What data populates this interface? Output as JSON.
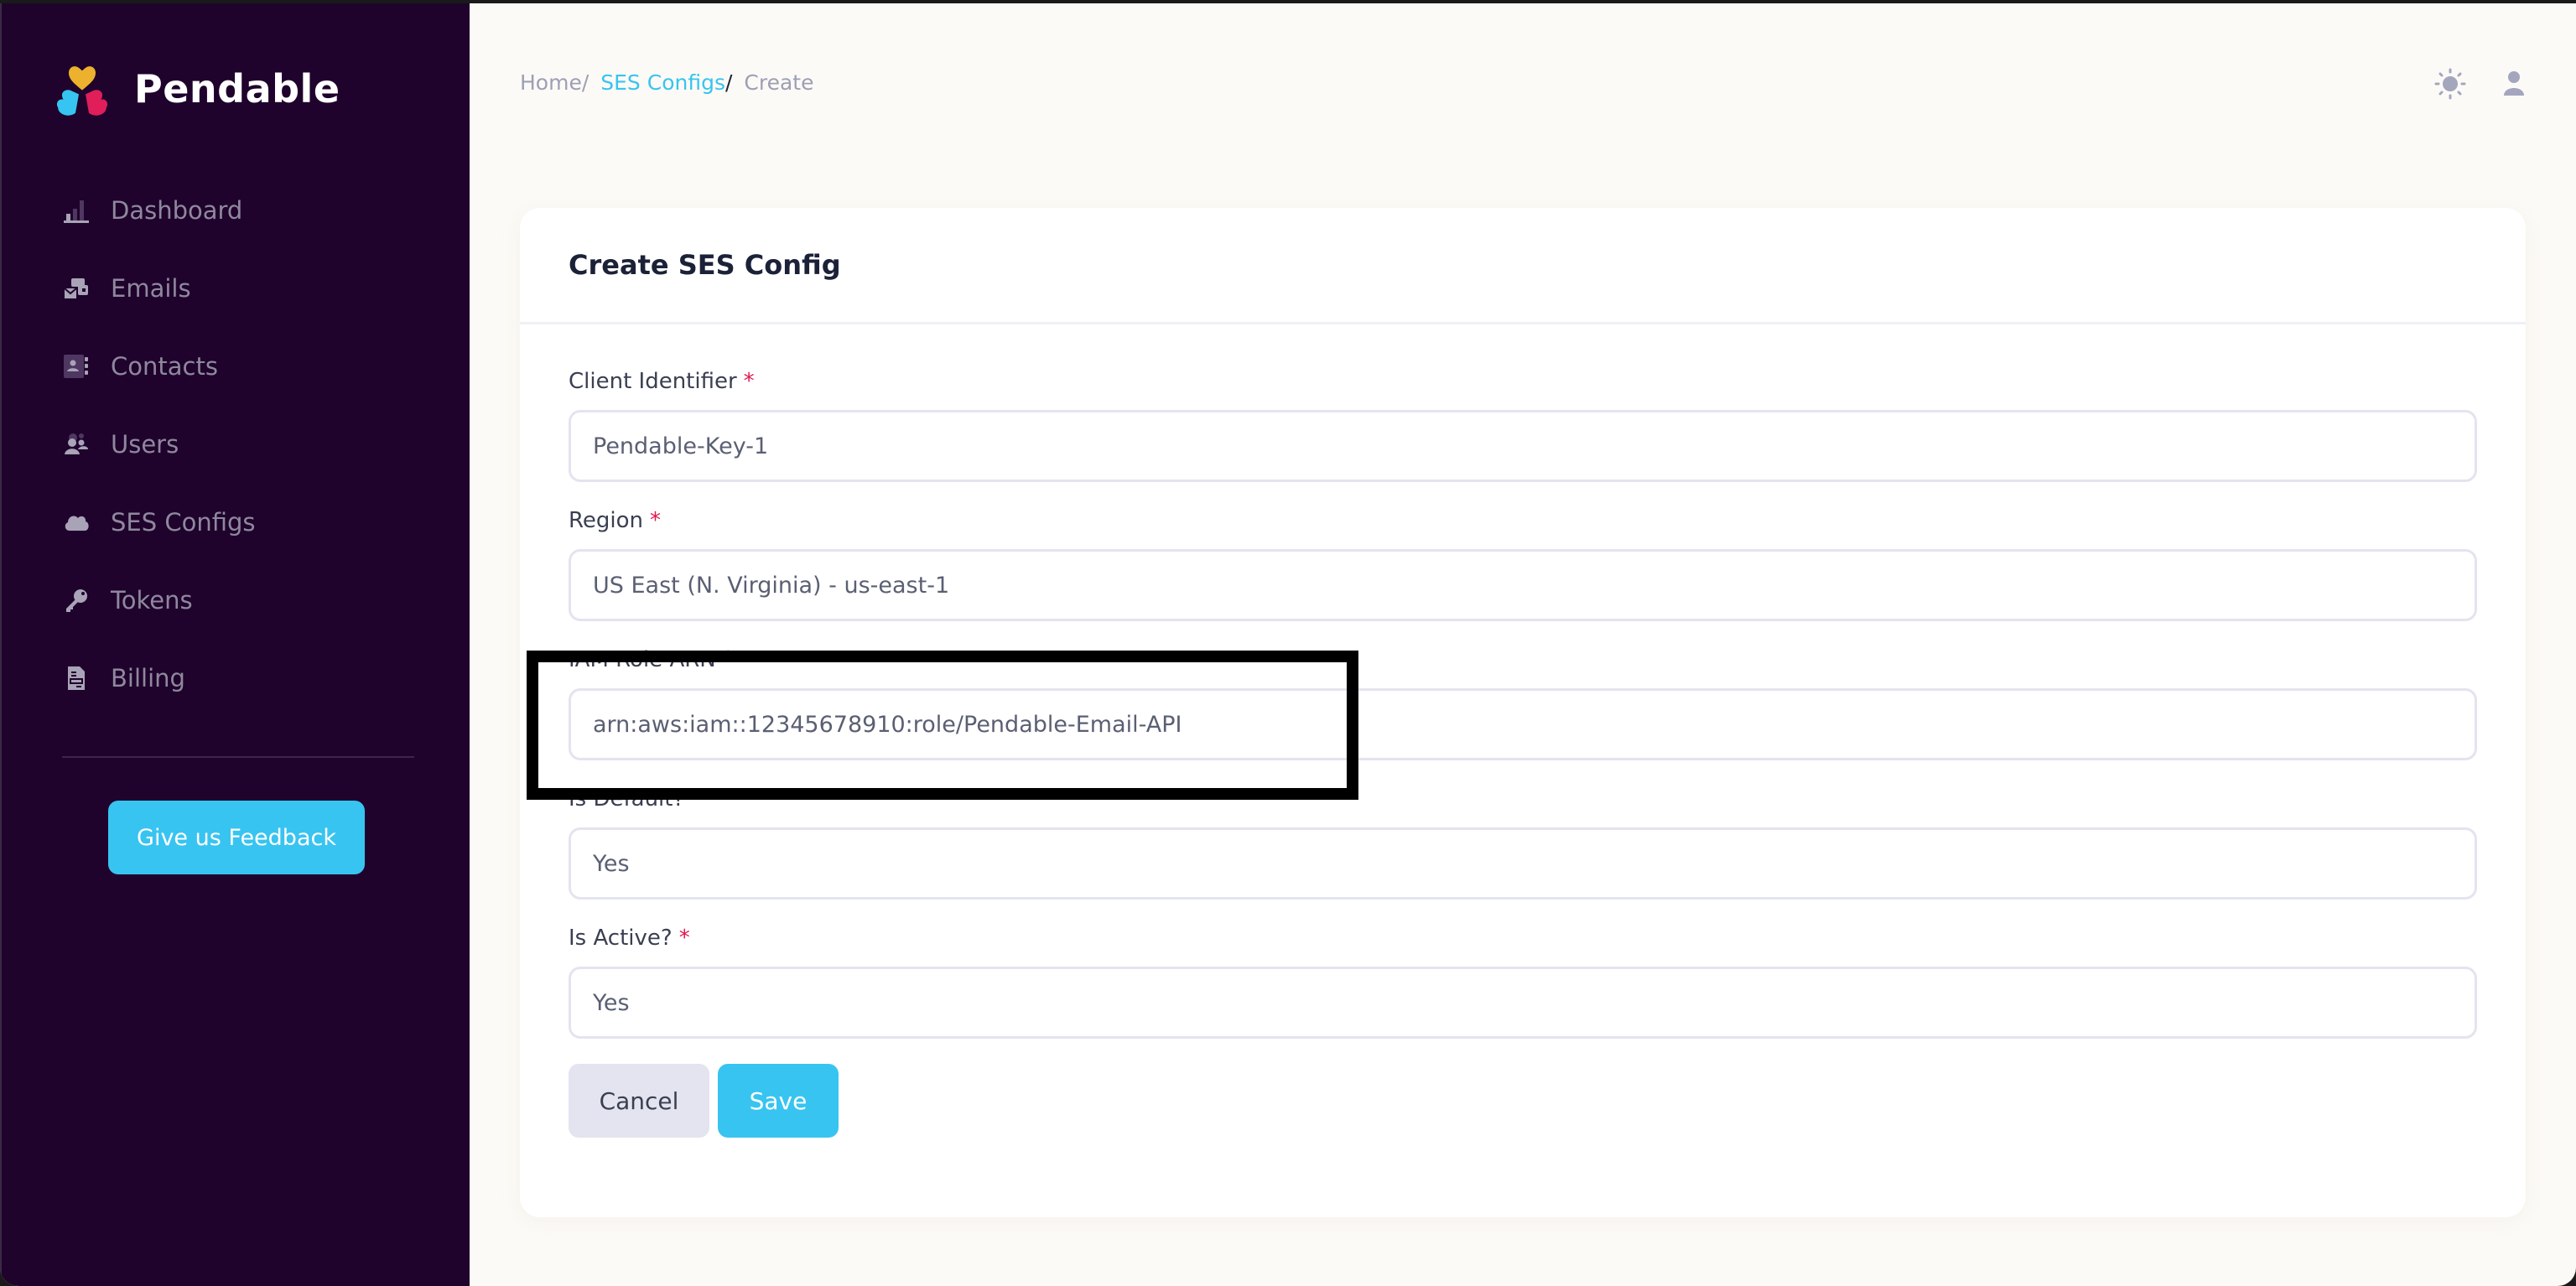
{
  "app": {
    "name": "Pendable",
    "brand_colors": {
      "accent": "#38c4f0",
      "sidebar_bg": "#1f032c",
      "required": "#e0194f"
    }
  },
  "sidebar": {
    "items": [
      {
        "label": "Dashboard",
        "icon": "bar-chart-icon"
      },
      {
        "label": "Emails",
        "icon": "emails-icon"
      },
      {
        "label": "Contacts",
        "icon": "contacts-book-icon"
      },
      {
        "label": "Users",
        "icon": "users-icon"
      },
      {
        "label": "SES Configs",
        "icon": "cloud-icon"
      },
      {
        "label": "Tokens",
        "icon": "key-icon"
      },
      {
        "label": "Billing",
        "icon": "invoice-icon"
      }
    ],
    "feedback_label": "Give us Feedback"
  },
  "breadcrumb": {
    "home": "Home",
    "separator": "/",
    "section": "SES Configs",
    "current": "Create"
  },
  "header": {
    "icons": [
      "sun-icon",
      "user-icon"
    ]
  },
  "form": {
    "title": "Create SES Config",
    "required_marker": "*",
    "fields": [
      {
        "label": "Client Identifier",
        "value": "Pendable-Key-1"
      },
      {
        "label": "Region",
        "value": "US East (N. Virginia) - us-east-1"
      },
      {
        "label": "IAM Role ARN",
        "value": "arn:aws:iam::12345678910:role/Pendable-Email-API"
      },
      {
        "label": "Is Default?",
        "value": "Yes"
      },
      {
        "label": "Is Active?",
        "value": "Yes"
      }
    ],
    "cancel_label": "Cancel",
    "save_label": "Save"
  }
}
